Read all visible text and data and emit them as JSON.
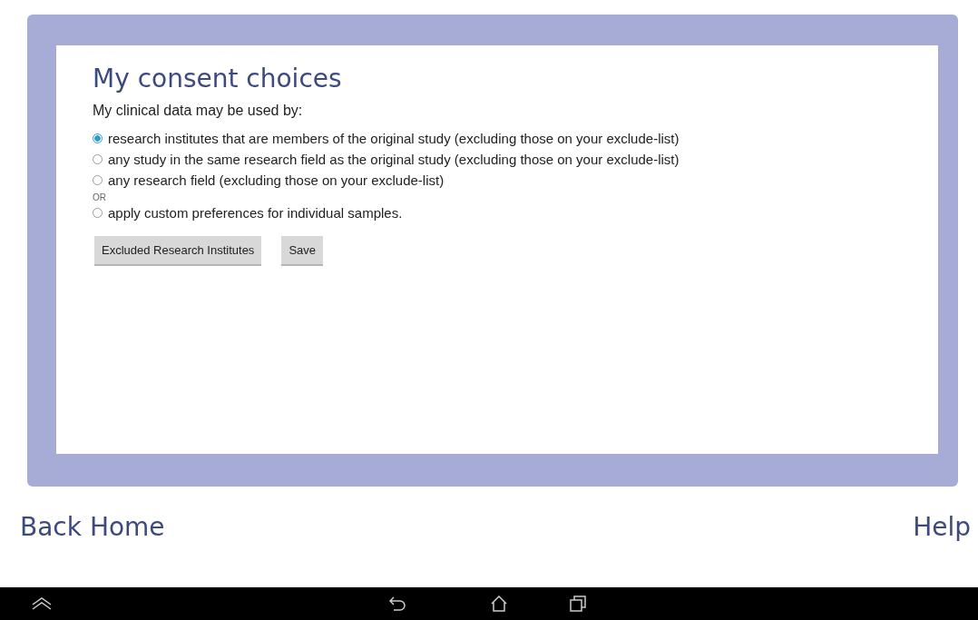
{
  "title": "My consent choices",
  "prompt": "My clinical data may be used by:",
  "options": [
    {
      "kind": "radio",
      "label": "research institutes that are members of the original study (excluding those on your exclude-list)",
      "selected": true
    },
    {
      "kind": "radio",
      "label": "any study in the same research field as the original study (excluding those on your exclude-list)",
      "selected": false
    },
    {
      "kind": "radio",
      "label": "any research field (excluding those on your exclude-list)",
      "selected": false
    },
    {
      "kind": "separator",
      "label": "OR"
    },
    {
      "kind": "radio",
      "label": "apply custom preferences for individual samples.",
      "selected": false
    }
  ],
  "buttons": [
    "Excluded Research Institutes",
    "Save"
  ],
  "footer": {
    "left": "Back Home",
    "right": "Help"
  }
}
